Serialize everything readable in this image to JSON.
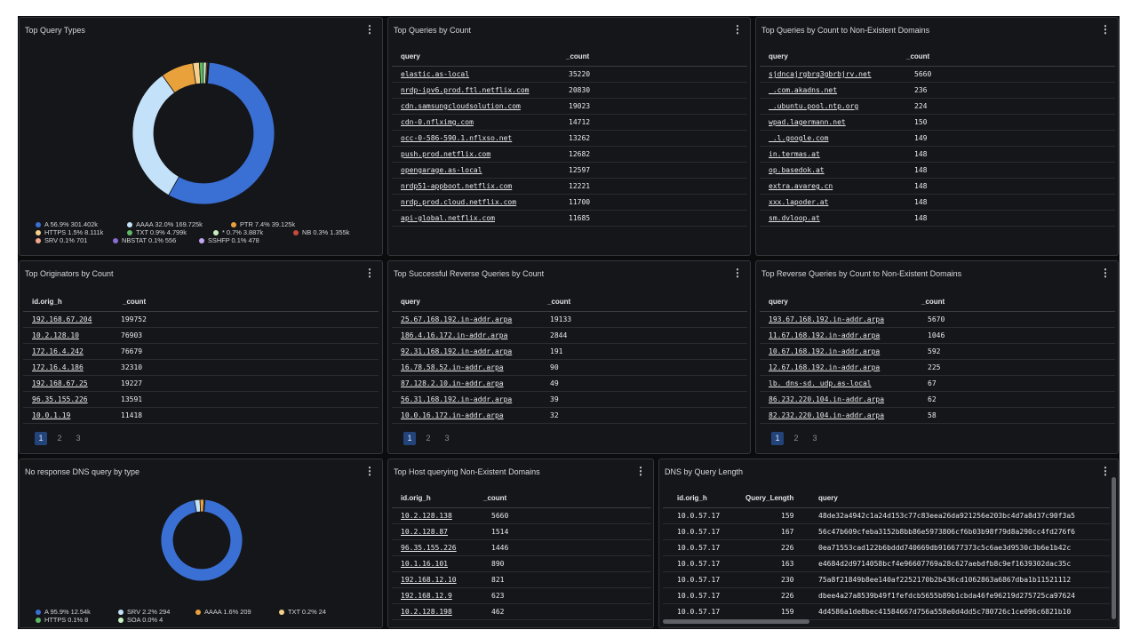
{
  "query_types": {
    "title": "Top Query Types",
    "legend": [
      {
        "label": "A 56.9% 301.402k",
        "color": "#3a6fd4",
        "value": 56.9
      },
      {
        "label": "AAAA 32.0% 169.725k",
        "color": "#c3e2fa",
        "value": 32.0
      },
      {
        "label": "PTR 7.4% 39.125k",
        "color": "#e9a23b",
        "value": 7.4
      },
      {
        "label": "HTTPS 1.5% 8.111k",
        "color": "#f4d08a",
        "value": 1.5
      },
      {
        "label": "TXT 0.9% 4.799k",
        "color": "#5fb865",
        "value": 0.9
      },
      {
        "label": "* 0.7% 3.887k",
        "color": "#c9f0c0",
        "value": 0.7
      },
      {
        "label": "NB 0.3% 1.355k",
        "color": "#c8493b",
        "value": 0.3
      },
      {
        "label": "SRV 0.1% 701",
        "color": "#f0a58d",
        "value": 0.1
      },
      {
        "label": "NBSTAT 0.1% 556",
        "color": "#8a6bd0",
        "value": 0.1
      },
      {
        "label": "SSHFP 0.1% 478",
        "color": "#c4a7f2",
        "value": 0.1
      }
    ]
  },
  "queries_by_count": {
    "title": "Top Queries by Count",
    "columns": [
      "query",
      "_count"
    ],
    "rows": [
      [
        "elastic.as-local",
        "35220"
      ],
      [
        "nrdp-ipv6.prod.ftl.netflix.com",
        "20830"
      ],
      [
        "cdn.samsungcloudsolution.com",
        "19023"
      ],
      [
        "cdn-0.nflximg.com",
        "14712"
      ],
      [
        "occ-0-586-590.1.nflxso.net",
        "13262"
      ],
      [
        "push.prod.netflix.com",
        "12682"
      ],
      [
        "opengarage.as-local",
        "12597"
      ],
      [
        "nrdp51-appboot.netflix.com",
        "12221"
      ],
      [
        "nrdp.prod.cloud.netflix.com",
        "11700"
      ],
      [
        "api-global.netflix.com",
        "11685"
      ]
    ]
  },
  "nxdomain_queries": {
    "title": "Top Queries by Count to Non-Existent Domains",
    "columns": [
      "query",
      "_count"
    ],
    "rows": [
      [
        "sjdncajrgbrq3gbrbjrv.net",
        "5660"
      ],
      [
        "_.com.akadns.net",
        "236"
      ],
      [
        "_.ubuntu.pool.ntp.org",
        "224"
      ],
      [
        "wpad.lagermann.net",
        "150"
      ],
      [
        "_.l.google.com",
        "149"
      ],
      [
        "in.termas.at",
        "148"
      ],
      [
        "op.basedok.at",
        "148"
      ],
      [
        "extra.avareg.cn",
        "148"
      ],
      [
        "xxx.lapoder.at",
        "148"
      ],
      [
        "sm.dvloop.at",
        "148"
      ]
    ]
  },
  "originators": {
    "title": "Top Originators by Count",
    "columns": [
      "id.orig_h",
      "_count"
    ],
    "rows": [
      [
        "192.168.67.204",
        "199752"
      ],
      [
        "10.2.128.10",
        "76903"
      ],
      [
        "172.16.4.242",
        "76679"
      ],
      [
        "172.16.4.186",
        "32310"
      ],
      [
        "192.168.67.25",
        "19227"
      ],
      [
        "96.35.155.226",
        "13591"
      ],
      [
        "10.0.1.19",
        "11418"
      ]
    ],
    "pages": [
      "1",
      "2",
      "3"
    ]
  },
  "reverse_success": {
    "title": "Top Successful Reverse Queries by Count",
    "columns": [
      "query",
      "_count"
    ],
    "rows": [
      [
        "25.67.168.192.in-addr.arpa",
        "19133"
      ],
      [
        "186.4.16.172.in-addr.arpa",
        "2844"
      ],
      [
        "92.31.168.192.in-addr.arpa",
        "191"
      ],
      [
        "16.78.58.52.in-addr.arpa",
        "90"
      ],
      [
        "87.128.2.10.in-addr.arpa",
        "49"
      ],
      [
        "56.31.168.192.in-addr.arpa",
        "39"
      ],
      [
        "10.0.16.172.in-addr.arpa",
        "32"
      ]
    ],
    "pages": [
      "1",
      "2",
      "3"
    ]
  },
  "reverse_nx": {
    "title": "Top Reverse Queries by Count to Non-Existent Domains",
    "columns": [
      "query",
      "_count"
    ],
    "rows": [
      [
        "193.67.168.192.in-addr.arpa",
        "5670"
      ],
      [
        "11.67.168.192.in-addr.arpa",
        "1046"
      ],
      [
        "10.67.168.192.in-addr.arpa",
        "592"
      ],
      [
        "12.67.168.192.in-addr.arpa",
        "225"
      ],
      [
        "lb._dns-sd._udp.as-local",
        "67"
      ],
      [
        "86.232.220.104.in-addr.arpa",
        "62"
      ],
      [
        "82.232.220.104.in-addr.arpa",
        "58"
      ]
    ],
    "pages": [
      "1",
      "2",
      "3"
    ]
  },
  "no_response": {
    "title": "No response DNS query by type",
    "legend": [
      {
        "label": "A 95.9% 12.54k",
        "color": "#3a6fd4",
        "value": 95.9
      },
      {
        "label": "SRV 2.2% 294",
        "color": "#c3e2fa",
        "value": 2.2
      },
      {
        "label": "AAAA 1.6% 209",
        "color": "#e9a23b",
        "value": 1.6
      },
      {
        "label": "TXT 0.2% 24",
        "color": "#f4d08a",
        "value": 0.2
      },
      {
        "label": "HTTPS 0.1% 8",
        "color": "#5fb865",
        "value": 0.1
      },
      {
        "label": "SOA 0.0% 4",
        "color": "#c9f0c0",
        "value": 0.04
      }
    ]
  },
  "host_nx": {
    "title": "Top Host querying Non-Existent Domains",
    "columns": [
      "id.orig_h",
      "_count"
    ],
    "rows": [
      [
        "10.2.128.138",
        "5660"
      ],
      [
        "10.2.128.87",
        "1514"
      ],
      [
        "96.35.155.226",
        "1446"
      ],
      [
        "10.1.16.101",
        "890"
      ],
      [
        "192.168.12.10",
        "821"
      ],
      [
        "192.168.12.9",
        "623"
      ],
      [
        "10.2.128.198",
        "462"
      ]
    ]
  },
  "query_length": {
    "title": "DNS by Query Length",
    "columns": [
      "id.orig_h",
      "Query_Length",
      "query"
    ],
    "rows": [
      [
        "10.0.57.17",
        "159",
        "48de32a4942c1a24d153c77c83eea26da921256e203bc4d7a8d37c90f3a5"
      ],
      [
        "10.0.57.17",
        "167",
        "56c47b609cfeba3152b8bb86e5973806cf6b03b98f79d8a290cc4fd276f6"
      ],
      [
        "10.0.57.17",
        "226",
        "0ea71553cad122b6bddd740669db916677373c5c6ae3d9530c3b6e1b42c"
      ],
      [
        "10.0.57.17",
        "163",
        "e4684d2d9714058bcf4e96607769a28c627aebdfb8c9ef1639302dac35c"
      ],
      [
        "10.0.57.17",
        "230",
        "75a8f21849b8ee140af2252170b2b436cd1062863a6867dba1b11521112"
      ],
      [
        "10.0.57.17",
        "226",
        "dbee4a27a8539b49f1fefdcb5655b89b1cbda46fe96219d275725ca97624"
      ],
      [
        "10.0.57.17",
        "159",
        "4d4586a1de8bec41584667d756a558e0d4dd5c780726c1ce096c6821b10"
      ]
    ]
  },
  "menu_glyph": "⋮"
}
